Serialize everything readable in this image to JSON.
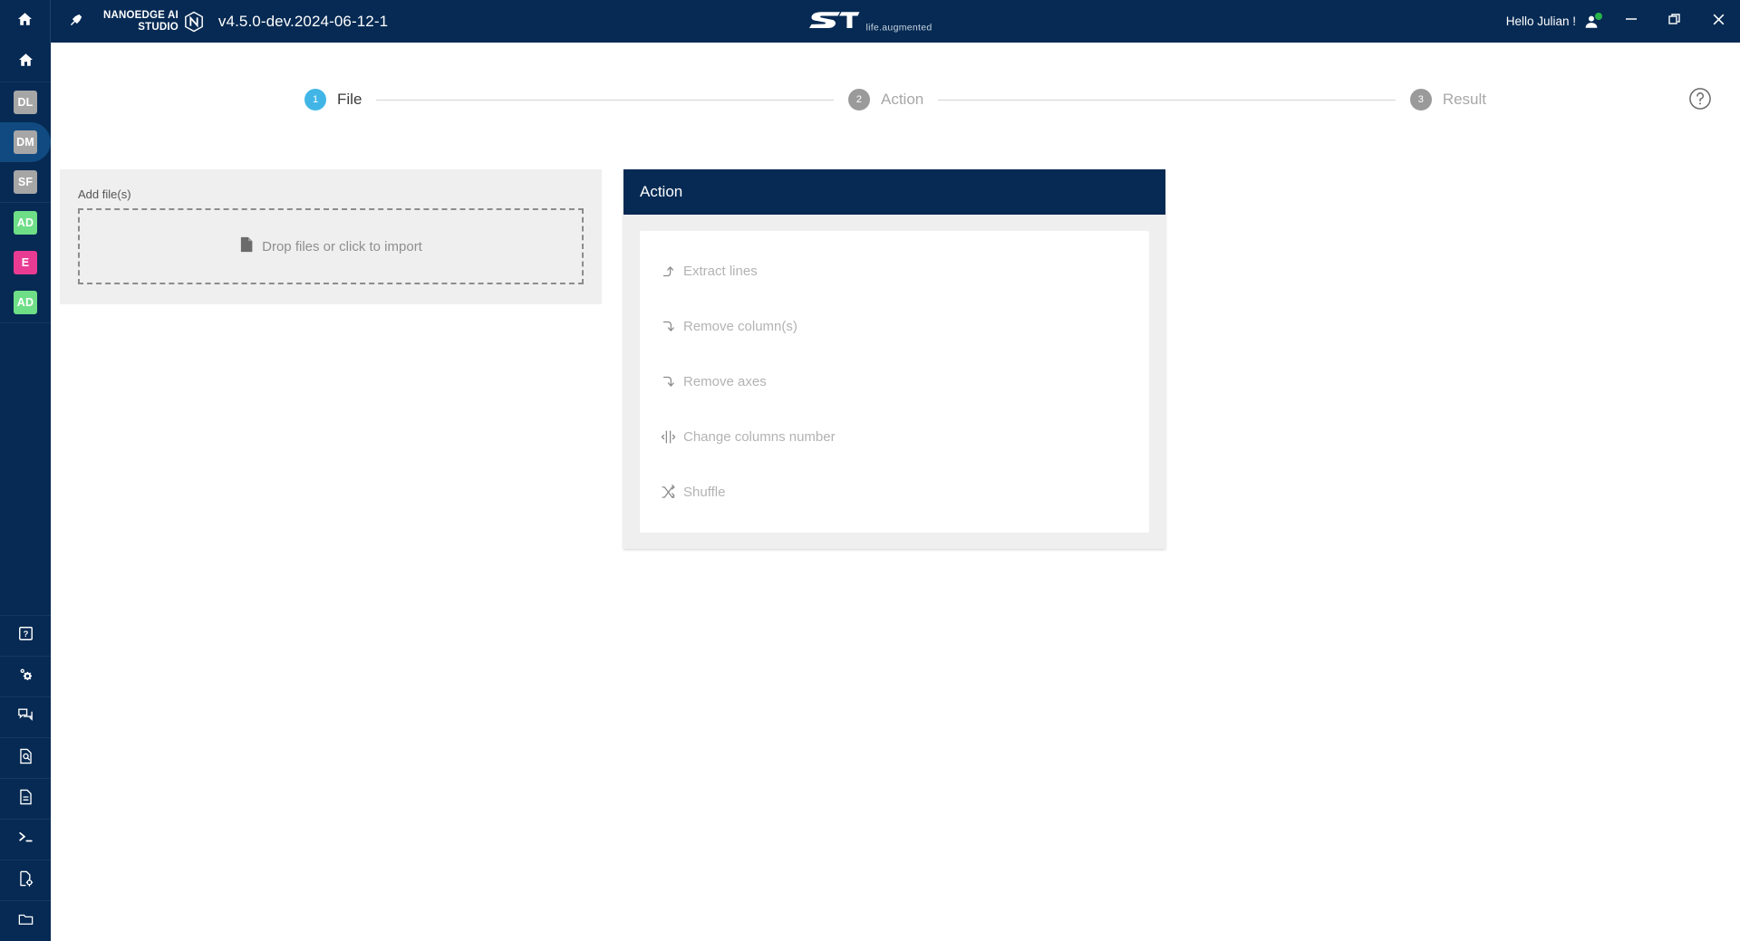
{
  "titlebar": {
    "home_icon": "home-icon",
    "pin_icon": "pin-icon",
    "brand_line1": "NANOEDGE AI",
    "brand_line2": "STUDIO",
    "brand_mark_icon": "nanoedge-n-logo-icon",
    "version": "v4.5.0-dev.2024-06-12-1",
    "st_logo_icon": "st-logo-icon",
    "st_tagline": "life.augmented",
    "user_greeting": "Hello Julian !",
    "user_icon": "user-avatar-icon",
    "status_dot_color": "#27b34a",
    "minimize_icon": "minimize-icon",
    "restore_icon": "restore-window-icon",
    "close_icon": "close-icon"
  },
  "sidebar": {
    "home_icon": "home-icon",
    "projects": [
      {
        "label": "DL",
        "color": "gray",
        "active": false,
        "name": "sidebar-item-dl"
      },
      {
        "label": "DM",
        "color": "gray",
        "active": true,
        "name": "sidebar-item-dm"
      },
      {
        "label": "SF",
        "color": "gray",
        "active": false,
        "name": "sidebar-item-sf"
      },
      {
        "label": "AD",
        "color": "green",
        "active": false,
        "name": "sidebar-item-ad-1"
      },
      {
        "label": "E",
        "color": "pink",
        "active": false,
        "name": "sidebar-item-e"
      },
      {
        "label": "AD",
        "color": "green",
        "active": false,
        "name": "sidebar-item-ad-2"
      }
    ],
    "tools": [
      {
        "icon": "help-icon",
        "name": "sidebar-tool-help"
      },
      {
        "icon": "settings-gears-icon",
        "name": "sidebar-tool-settings"
      },
      {
        "icon": "chat-bubbles-icon",
        "name": "sidebar-tool-chat"
      },
      {
        "icon": "document-search-icon",
        "name": "sidebar-tool-document-search"
      },
      {
        "icon": "document-icon",
        "name": "sidebar-tool-document"
      },
      {
        "icon": "terminal-icon",
        "name": "sidebar-tool-terminal"
      },
      {
        "icon": "document-settings-icon",
        "name": "sidebar-tool-document-settings"
      },
      {
        "icon": "folder-open-icon",
        "name": "sidebar-tool-folder"
      }
    ]
  },
  "stepper": {
    "steps": [
      {
        "num": "1",
        "label": "File",
        "state": "active"
      },
      {
        "num": "2",
        "label": "Action",
        "state": "idle"
      },
      {
        "num": "3",
        "label": "Result",
        "state": "idle"
      }
    ],
    "help_icon": "help-circle-icon",
    "active_color": "#41b6e6",
    "idle_color": "#9a9a9a"
  },
  "file_panel": {
    "label": "Add file(s)",
    "dropzone_text": "Drop files or click to import",
    "dropzone_icon": "file-icon"
  },
  "action_panel": {
    "title": "Action",
    "header_color": "#062A53",
    "items": [
      {
        "label": "Extract lines",
        "icon": "arrow-turn-up-icon",
        "name": "action-extract-lines"
      },
      {
        "label": "Remove column(s)",
        "icon": "arrow-turn-down-icon",
        "name": "action-remove-columns"
      },
      {
        "label": "Remove axes",
        "icon": "arrow-turn-down-icon",
        "name": "action-remove-axes"
      },
      {
        "label": "Change columns number",
        "icon": "horizontal-resize-icon",
        "name": "action-change-columns-number"
      },
      {
        "label": "Shuffle",
        "icon": "shuffle-icon",
        "name": "action-shuffle"
      }
    ]
  }
}
